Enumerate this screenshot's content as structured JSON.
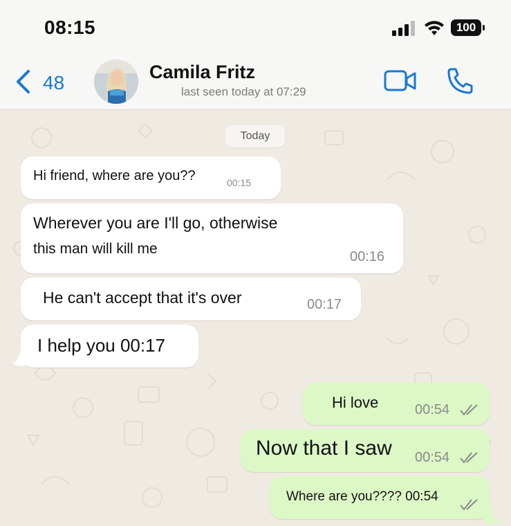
{
  "status_bar": {
    "time": "08:15",
    "battery": "100"
  },
  "header": {
    "back_count": "48",
    "contact_name": "Camila Fritz",
    "last_seen": "last seen today at 07:29",
    "video_icon": "video-camera-icon",
    "call_icon": "phone-icon"
  },
  "chat": {
    "date_label": "Today",
    "messages": [
      {
        "direction": "in",
        "text": "Hi friend, where are you??",
        "time": "00:15"
      },
      {
        "direction": "in",
        "text_line1": "Wherever you are I'll go, otherwise",
        "text_line2": "this man will kill me",
        "time": "00:16"
      },
      {
        "direction": "in",
        "text": "He can't accept that it's over",
        "time": "00:17"
      },
      {
        "direction": "in",
        "text": "I help you 00:17"
      },
      {
        "direction": "out",
        "text": "Hi love",
        "time": "00:54",
        "status": "read"
      },
      {
        "direction": "out",
        "text": "Now that I saw",
        "time": "00:54",
        "status": "read"
      },
      {
        "direction": "out",
        "text": "Where are you???? 00:54",
        "status": "read"
      }
    ]
  },
  "colors": {
    "accent": "#1877d4",
    "incoming_bubble": "#ffffff",
    "outgoing_bubble": "#dcf8c6",
    "chat_background": "#efeae2"
  }
}
